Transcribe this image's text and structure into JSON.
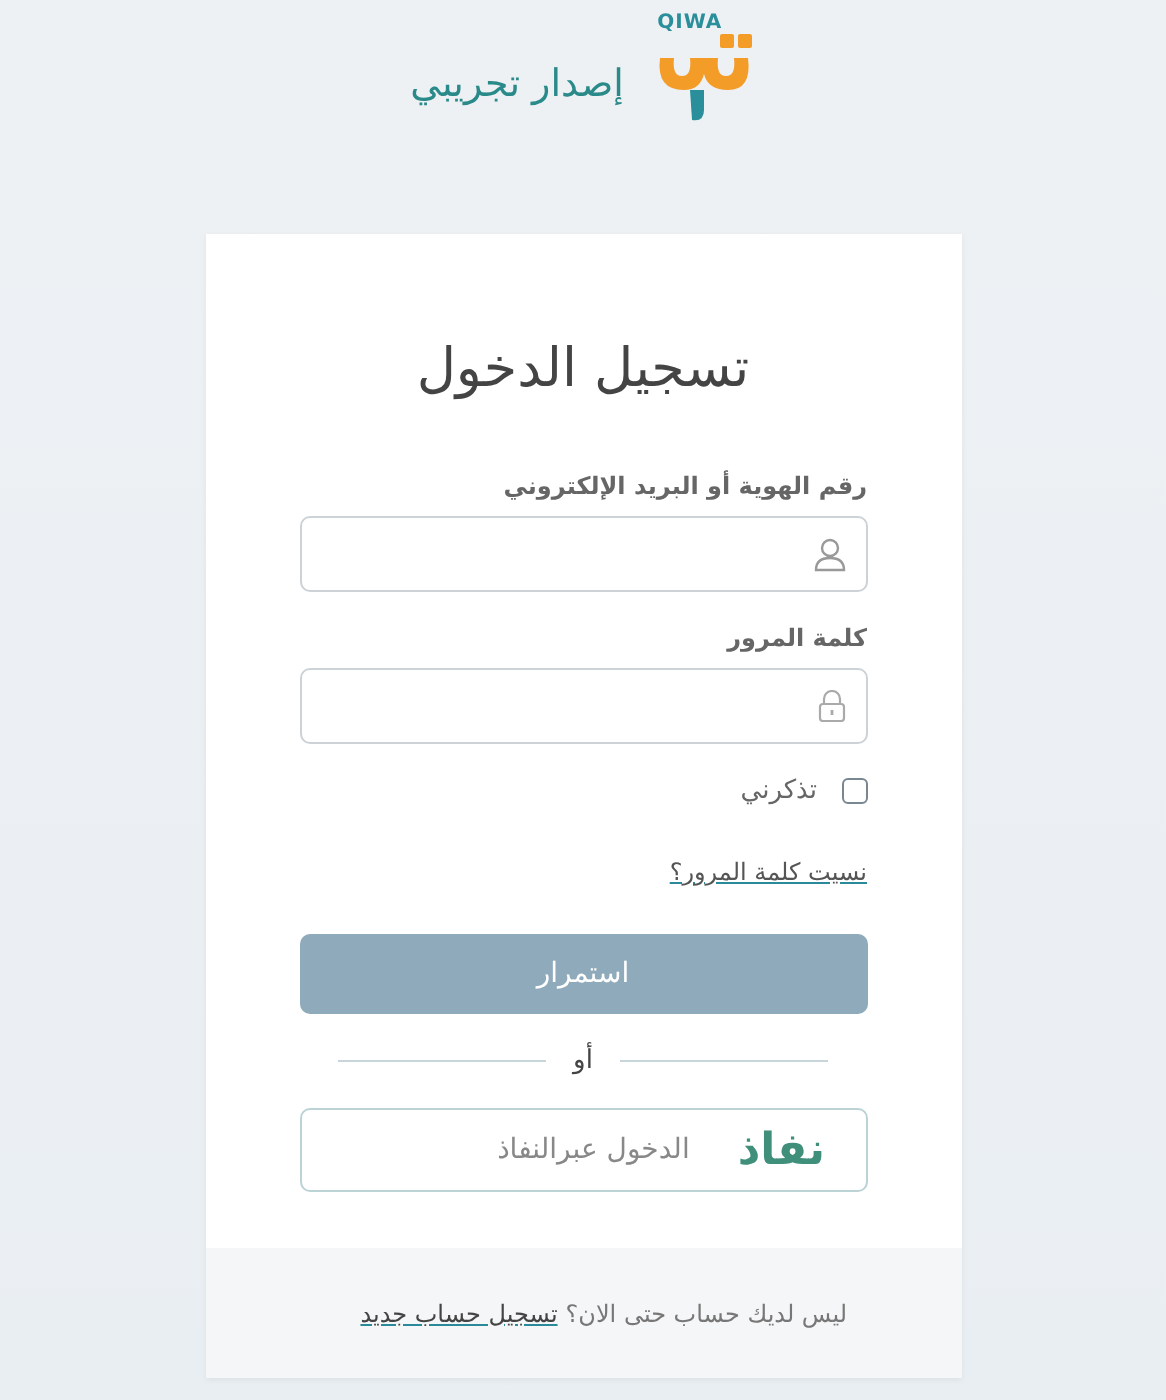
{
  "header": {
    "brand": "QIWA",
    "subtitle": "إصدار تجريبي"
  },
  "login": {
    "title": "تسجيل الدخول",
    "fields": [
      {
        "label": "رقم الهوية أو البريد الإلكتروني",
        "kind": "user"
      },
      {
        "label": "كلمة المرور",
        "kind": "password"
      }
    ],
    "remember": {
      "label": "تذكرني",
      "checked": false
    },
    "forgot_link": "نسيت كلمة المرور؟",
    "continue_button": {
      "label": "استمرار",
      "disabled": true
    },
    "divider": "أو",
    "nafath_button": {
      "logo": "نفاذ",
      "label": "الدخول عبرالنفاذ"
    }
  },
  "footer": {
    "prompt": "ليس لديك حساب حتى الان؟",
    "register_link": "تسجيل حساب جديد"
  }
}
